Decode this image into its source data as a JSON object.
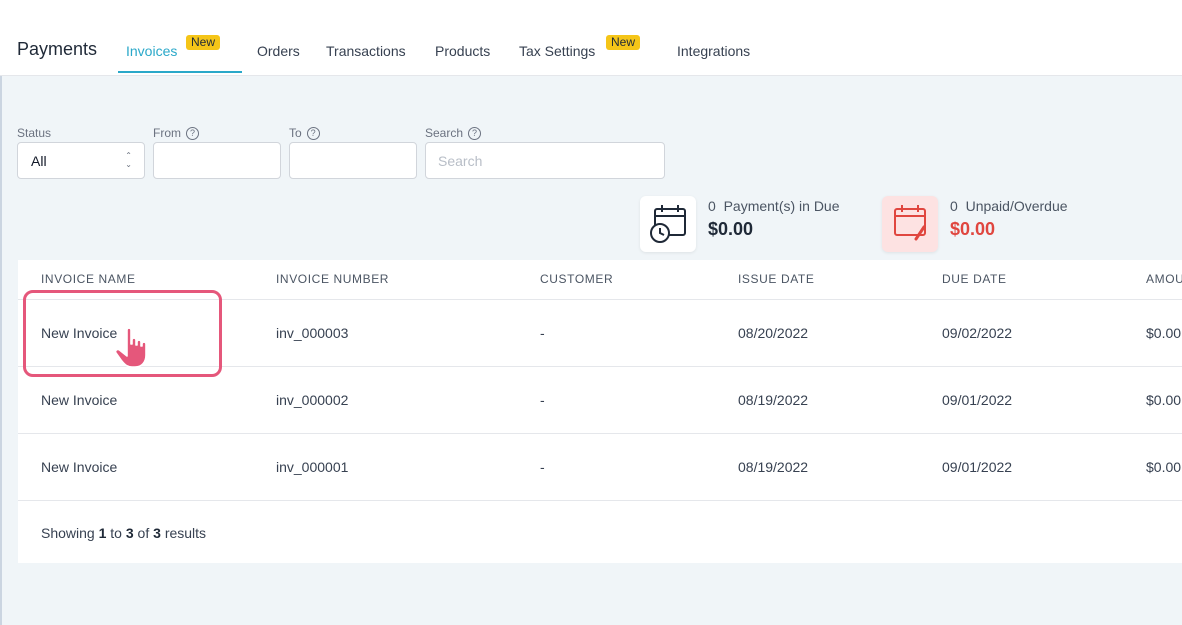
{
  "header": {
    "title": "Payments",
    "tabs": [
      {
        "label": "Invoices",
        "badge": "New",
        "active": true
      },
      {
        "label": "Orders"
      },
      {
        "label": "Transactions"
      },
      {
        "label": "Products"
      },
      {
        "label": "Tax Settings",
        "badge": "New"
      },
      {
        "label": "Integrations"
      }
    ]
  },
  "filters": {
    "status": {
      "label": "Status",
      "value": "All"
    },
    "from": {
      "label": "From",
      "help_icon": "question-circle-icon"
    },
    "to": {
      "label": "To",
      "help_icon": "question-circle-icon"
    },
    "search": {
      "label": "Search",
      "placeholder": "Search",
      "help_icon": "question-circle-icon"
    }
  },
  "summary": {
    "due": {
      "icon": "calendar-clock-icon",
      "count": "0",
      "label": "Payment(s) in Due",
      "amount": "$0.00"
    },
    "unpaid": {
      "icon": "calendar-edit-icon",
      "count": "0",
      "label": "Unpaid/Overdue",
      "amount": "$0.00",
      "color": "#e0463f"
    }
  },
  "table": {
    "columns": [
      "INVOICE NAME",
      "INVOICE NUMBER",
      "CUSTOMER",
      "ISSUE DATE",
      "DUE DATE",
      "AMOUNT"
    ],
    "rows": [
      {
        "name": "New Invoice",
        "number": "inv_000003",
        "customer": "-",
        "issue": "08/20/2022",
        "due": "09/02/2022",
        "amount": "$0.00"
      },
      {
        "name": "New Invoice",
        "number": "inv_000002",
        "customer": "-",
        "issue": "08/19/2022",
        "due": "09/01/2022",
        "amount": "$0.00"
      },
      {
        "name": "New Invoice",
        "number": "inv_000001",
        "customer": "-",
        "issue": "08/19/2022",
        "due": "09/01/2022",
        "amount": "$0.00"
      }
    ],
    "footer": {
      "prefix": "Showing",
      "from": "1",
      "to_word": "to",
      "to": "3",
      "of_word": "of",
      "total": "3",
      "suffix": "results"
    }
  },
  "colors": {
    "accent": "#2aa8c9",
    "badge": "#f5c518",
    "highlight": "#e5577b",
    "danger": "#e0463f"
  }
}
